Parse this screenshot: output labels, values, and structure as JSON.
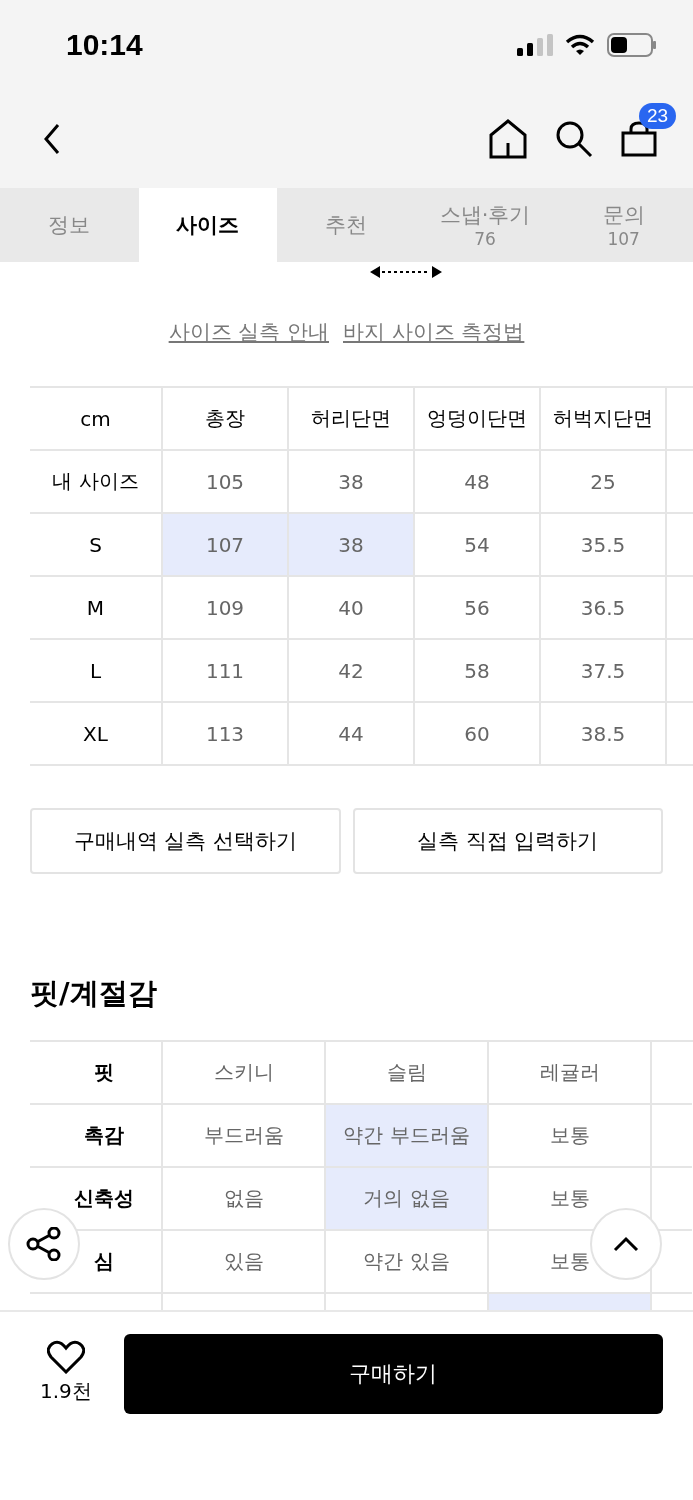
{
  "status_bar": {
    "time": "10:14"
  },
  "tabs": [
    {
      "label": "정보",
      "selected": false
    },
    {
      "label": "사이즈",
      "selected": true
    },
    {
      "label": "추천",
      "selected": false
    },
    {
      "label": "스냅·후기",
      "count": "76",
      "selected": false
    },
    {
      "label": "문의",
      "count": "107",
      "selected": false
    }
  ],
  "cart_badge": "23",
  "links": [
    "사이즈 실측 안내",
    "바지 사이즈 측정법"
  ],
  "size_table": {
    "corner": "cm",
    "columns": [
      "총장",
      "허리단면",
      "엉덩이단면",
      "허벅지단면"
    ],
    "rows": [
      {
        "label": "내 사이즈",
        "cells": [
          {
            "text": "105",
            "selected": false
          },
          {
            "text": "38",
            "selected": false
          },
          {
            "text": "48",
            "selected": false
          },
          {
            "text": "25",
            "selected": false
          }
        ]
      },
      {
        "label": "S",
        "cells": [
          {
            "text": "107",
            "selected": true
          },
          {
            "text": "38",
            "selected": true
          },
          {
            "text": "54",
            "selected": false
          },
          {
            "text": "35.5",
            "selected": false
          }
        ]
      },
      {
        "label": "M",
        "cells": [
          {
            "text": "109",
            "selected": false
          },
          {
            "text": "40",
            "selected": false
          },
          {
            "text": "56",
            "selected": false
          },
          {
            "text": "36.5",
            "selected": false
          }
        ]
      },
      {
        "label": "L",
        "cells": [
          {
            "text": "111",
            "selected": false
          },
          {
            "text": "42",
            "selected": false
          },
          {
            "text": "58",
            "selected": false
          },
          {
            "text": "37.5",
            "selected": false
          }
        ]
      },
      {
        "label": "XL",
        "cells": [
          {
            "text": "113",
            "selected": false
          },
          {
            "text": "44",
            "selected": false
          },
          {
            "text": "60",
            "selected": false
          },
          {
            "text": "38.5",
            "selected": false
          }
        ]
      }
    ]
  },
  "size_buttons": [
    "구매내역 실측 선택하기",
    "실측 직접 입력하기"
  ],
  "fit_section": {
    "title": "핏/계절감",
    "rows": [
      {
        "label": "핏",
        "cells": [
          {
            "text": "스키니",
            "selected": false
          },
          {
            "text": "슬림",
            "selected": false
          },
          {
            "text": "레귤러",
            "selected": false
          }
        ]
      },
      {
        "label": "촉감",
        "cells": [
          {
            "text": "부드러움",
            "selected": false
          },
          {
            "text": "약간 부드러움",
            "selected": true
          },
          {
            "text": "보통",
            "selected": false
          }
        ]
      },
      {
        "label": "신축성",
        "cells": [
          {
            "text": "없음",
            "selected": false
          },
          {
            "text": "거의 없음",
            "selected": true
          },
          {
            "text": "보통",
            "selected": false
          }
        ]
      },
      {
        "label": "심",
        "cells": [
          {
            "text": "있음",
            "selected": false
          },
          {
            "text": "약간 있음",
            "selected": false
          },
          {
            "text": "보통",
            "selected": false
          }
        ]
      }
    ]
  },
  "bottom_bar": {
    "likes": "1.9천",
    "buy_button": "구매하기"
  }
}
